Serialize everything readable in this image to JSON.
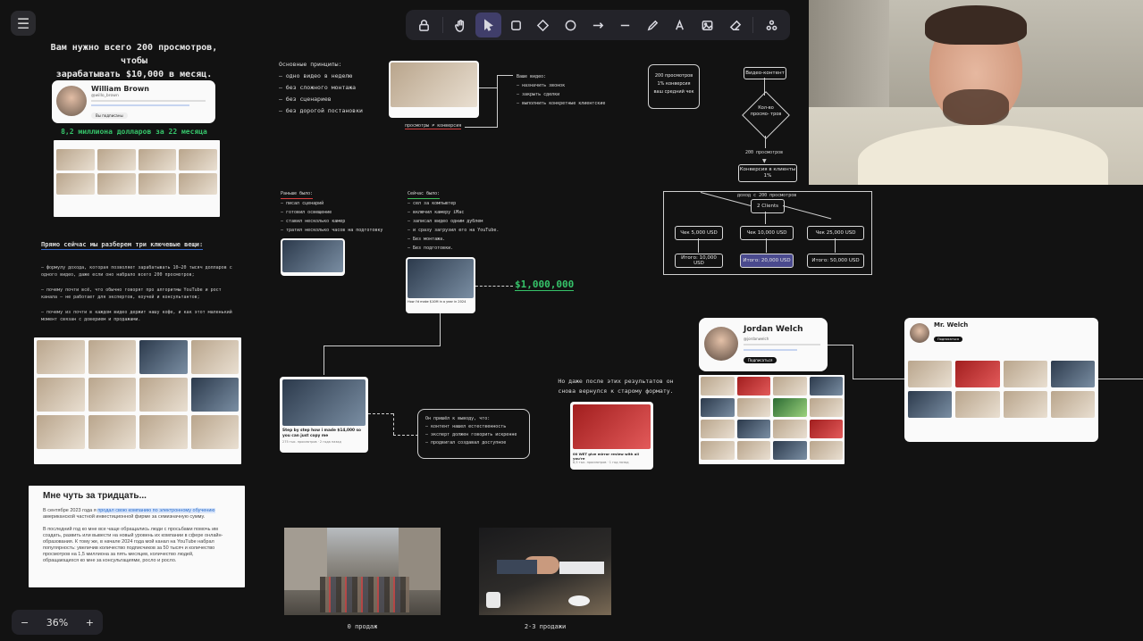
{
  "toolbar": {
    "menu_icon": "hamburger-icon",
    "tools": [
      "lock-icon",
      "hand-icon",
      "select-pointer-icon",
      "rectangle-icon",
      "diamond-icon",
      "circle-icon",
      "arrow-icon",
      "line-icon",
      "pencil-icon",
      "text-icon",
      "image-icon",
      "eraser-icon",
      "library-icon"
    ],
    "active_tool": "select-pointer-icon"
  },
  "zoom": {
    "minus": "−",
    "value": "36%",
    "plus": "+"
  },
  "left_header": {
    "line1": "Вам нужно всего 200 просмотров, чтобы",
    "line2": "зарабатывать $10,000 в месяц."
  },
  "william_card": {
    "name": "William Brown",
    "handle": "@willo_brown",
    "button": "Вы подписаны"
  },
  "green_heading": "8,2 миллиона долларов за 22 месяца",
  "topics": {
    "title": "Прямо сейчас мы разберем три ключевые вещи:",
    "items": [
      "— формулу дохода, которая позволяет зарабатывать 10–20 тысяч долларов с одного видео, даже если оно набрало всего 200 просмотров;",
      "— почему почти всё, что обычно говорят про алгоритмы YouTube и рост канала — не работает для экспертов, коучей и консультантов;",
      "— почему из почти в каждом видео держит нашу кофе, и как этот маленький момент связан с доверием и продажами."
    ]
  },
  "bio": {
    "title": "Мне чуть за тридцать...",
    "p1_pre": "В сентябре 2023 года я ",
    "p1_link": "продал свою компанию по электронному обучению",
    "p1_post": " американской частной инвестиционной фирме за семизначную сумму.",
    "p2": "В последний год ко мне все чаще обращались люди с просьбами помочь им создать, развить или вывести на новый уровень их компании в сфере онлайн-образования. К тому же, в начале 2024 года мой канал на YouTube набрал популярность: увеличив количество подписчиков за 50 тысяч и количество просмотров на 1,5 миллиона за пять месяцев, количество людей, обращающихся ко мне за консультациями, росло и росло."
  },
  "principles": {
    "title": "Основные принципы:",
    "items": [
      "– одно видео в неделю",
      "– без сложного монтажа",
      "– без сценариев",
      "– без дорогой постановки"
    ]
  },
  "conversion_label": "просмотры ≠ конверсия",
  "video_goals": {
    "title": "Ваше видео:",
    "items": [
      "– назначить звонок",
      "– закрыть сделки",
      "– выполнить конкретные клиентские"
    ]
  },
  "stat_box": {
    "line1": "200 просмотров",
    "line2": "1% конверсия",
    "line3": "ваш средний чек"
  },
  "flow": {
    "content": "Видео-контент",
    "diamond": "Кол-во просмо- тров",
    "views": "200 просмотров",
    "convert": "Конверсия в клиенты 1%"
  },
  "income": {
    "title": "доход с 200 просмотров",
    "clients": "2 Clients",
    "checks": [
      "Чек 5,000 USD",
      "Чек 10,000 USD",
      "Чек 25,000 USD"
    ],
    "totals": [
      "Итого: 10,000 USD",
      "Итого: 20,000 USD",
      "Итого: 50,000 USD"
    ],
    "colors": {
      "highlight": "#4a4a8e"
    }
  },
  "early": {
    "title": "Раньше было:",
    "items": [
      "– писал сценарий",
      "– готовил освещение",
      "– ставил несколько камер",
      "– тратил несколько часов на подготовку"
    ]
  },
  "now": {
    "title": "Сейчас было:",
    "items": [
      "– сел за компьютер",
      "– включил камеру iMac",
      "– записал видео одним дублем",
      "– и сразу загрузил его на YouTube.",
      "– Без монтажа.",
      "– Без подготовки."
    ]
  },
  "million": "$1,000,000",
  "video_captions": {
    "center": "How I'd make $10M in a year in 2024",
    "step": "Step by step how i made $14,000 so you can just copy me",
    "step_meta": "275 тыс. просмотров · 2 года назад",
    "best": "00 WET give mirror review with all you're",
    "best_meta": "8,5 тыс. просмотров · 1 год назад"
  },
  "conclusion": {
    "title": "Он пришёл к выводу, что:",
    "items": [
      "– контент нашел естественность",
      "– эксперт должен говорить искренне",
      "– продвигал создавал доступное"
    ]
  },
  "return_note": {
    "line1": "Но даже после этих результатов он",
    "line2": "снова вернулся к старому формату."
  },
  "jordan": {
    "name": "Jordan Welch",
    "handle": "@jordanwelch",
    "button": "Подписаться"
  },
  "welch": {
    "name": "Mr. Welch",
    "button": "Подписаться"
  },
  "photos": {
    "street_caption": "0 продаж",
    "handshake_caption": "2-3 продажи"
  }
}
